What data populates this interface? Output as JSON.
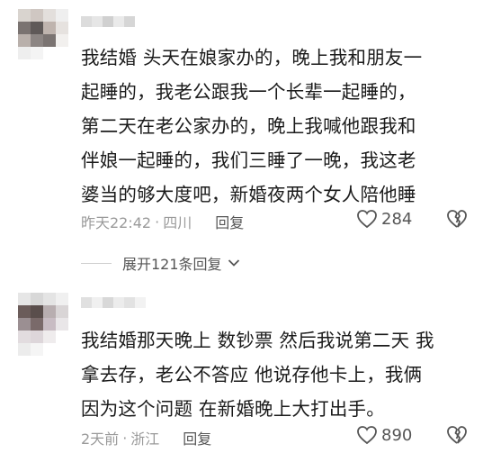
{
  "comments": [
    {
      "text_lines": [
        "我结婚 头天在娘家办的，晚上我和朋友一",
        "起睡的，我老公跟我一个长辈一起睡的，",
        "第二天在老公家办的，晚上我喊他跟我和",
        "伴娘一起睡的，我们三睡了一晚，我这老",
        "婆当的够大度吧，新婚夜两个女人陪他睡"
      ],
      "time": "昨天22:42",
      "separator": "·",
      "location": "四川",
      "reply_label": "回复",
      "likes": "284",
      "expand_label": "展开121条回复"
    },
    {
      "text_lines": [
        "我结婚那天晚上 数钞票 然后我说第二天 我",
        "拿去存，老公不答应 他说存他卡上，我俩",
        "因为这个问题 在新婚晚上大打出手。"
      ],
      "time": "2天前",
      "separator": "·",
      "location": "浙江",
      "reply_label": "回复",
      "likes": "890"
    }
  ],
  "icons": {
    "like": "heart-outline-icon",
    "dislike": "broken-heart-icon",
    "expand": "chevron-down-icon",
    "avatar": "pixelated-avatar"
  },
  "colors": {
    "text": "#1b1b1b",
    "meta": "#9a9a9a",
    "icon": "#555555"
  }
}
